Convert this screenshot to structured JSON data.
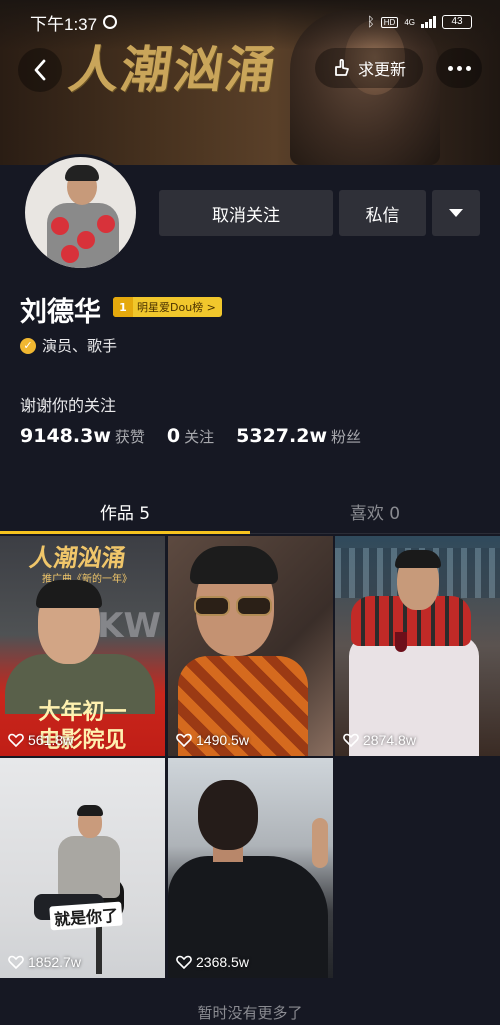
{
  "status_bar": {
    "time": "下午1:37",
    "hd": "HD",
    "network": "4G",
    "battery": "43"
  },
  "header": {
    "banner_title": "人潮汹涌",
    "update_label": "求更新"
  },
  "profile": {
    "name": "刘德华",
    "rank_number": "1",
    "rank_label": "明星爱Dou榜 >",
    "verification": "演员、歌手",
    "bio": "谢谢你的关注",
    "stats": {
      "likes_value": "9148.3w",
      "likes_label": "获赞",
      "following_value": "0",
      "following_label": "关注",
      "followers_value": "5327.2w",
      "followers_label": "粉丝"
    }
  },
  "actions": {
    "unfollow_label": "取消关注",
    "message_label": "私信"
  },
  "tabs": [
    {
      "label": "作品 5",
      "active": true
    },
    {
      "label": "喜欢 0",
      "active": false
    }
  ],
  "videos": [
    {
      "likes": "561.8w",
      "poster_title": "人潮汹涌",
      "poster_sub": "推广曲《新的一年》",
      "caption_line1": "大年初一",
      "caption_line2": "电影院见",
      "poster_mark": "KW"
    },
    {
      "likes": "1490.5w"
    },
    {
      "likes": "2874.8w"
    },
    {
      "likes": "1852.7w",
      "caption": "就是你了"
    },
    {
      "likes": "2368.5w"
    }
  ],
  "footer": {
    "no_more": "暂时没有更多了"
  },
  "colors": {
    "background": "#161823",
    "button_bg": "#2f3038",
    "accent_yellow": "#f6c31f",
    "verify_gold": "#f0b731"
  }
}
